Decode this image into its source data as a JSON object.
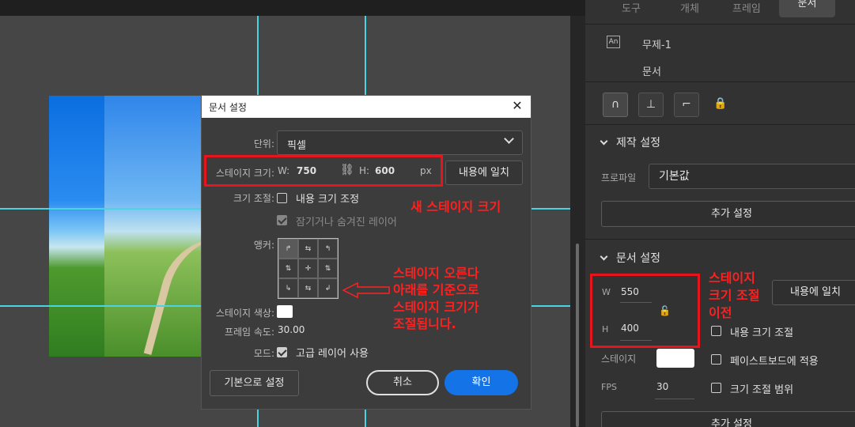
{
  "right_tabs": [
    "도구",
    "개체",
    "프레임",
    "문서"
  ],
  "doc": {
    "icon_label": "An",
    "name": "무제-1",
    "type": "문서"
  },
  "prod_section": {
    "title": "제작 설정",
    "profile_label": "프로파일",
    "profile_value": "기본값",
    "more_button": "추가 설정"
  },
  "doc_section": {
    "title": "문서 설정",
    "w_label": "W",
    "w_value": "550",
    "h_label": "H",
    "h_value": "400",
    "fit_button": "내용에 일치",
    "stage_label": "스테이지",
    "fps_label": "FPS",
    "fps_value": "30",
    "opt_scale_content": "내용 크기 조절",
    "opt_pasteboard": "페이스트보드에 적용",
    "opt_scale_range": "크기 조절 범위",
    "more_button": "추가 설정",
    "stage_color": "#ffffff"
  },
  "dialog": {
    "title": "문서 설정",
    "unit_label": "단위:",
    "unit_value": "픽셀",
    "stage_size_label": "스테이지 크기:",
    "w_label": "W:",
    "w_value": "750",
    "h_label": "H:",
    "h_value": "600",
    "px": "px",
    "fit_button": "내용에 일치",
    "scale_label": "크기 조절:",
    "scale_content": "내용 크기 조정",
    "locked_layers": "잠기거나 숨겨진 레이어",
    "anchor_label": "앵커:",
    "stage_color_label": "스테이지 색상:",
    "stage_color": "#ffffff",
    "fps_label": "프레임 속도:",
    "fps_value": "30.00",
    "mode_label": "모드:",
    "mode_value": "고급 레이어 사용",
    "reset_button": "기본으로 설정",
    "cancel_button": "취소",
    "ok_button": "확인"
  },
  "annotations": {
    "new_size": "새 스테이지 크기",
    "anchor_note_1": "스테이지 오른다",
    "anchor_note_2": "아래를 기준으로",
    "anchor_note_3": "스테이지 크기가",
    "anchor_note_4": "조절됩니다.",
    "before_1": "스테이지",
    "before_2": "크기 조절",
    "before_3": "이전"
  },
  "colors": {
    "accent": "#1473e6",
    "guide": "#4ad4e0",
    "annotation": "#e8141b"
  }
}
